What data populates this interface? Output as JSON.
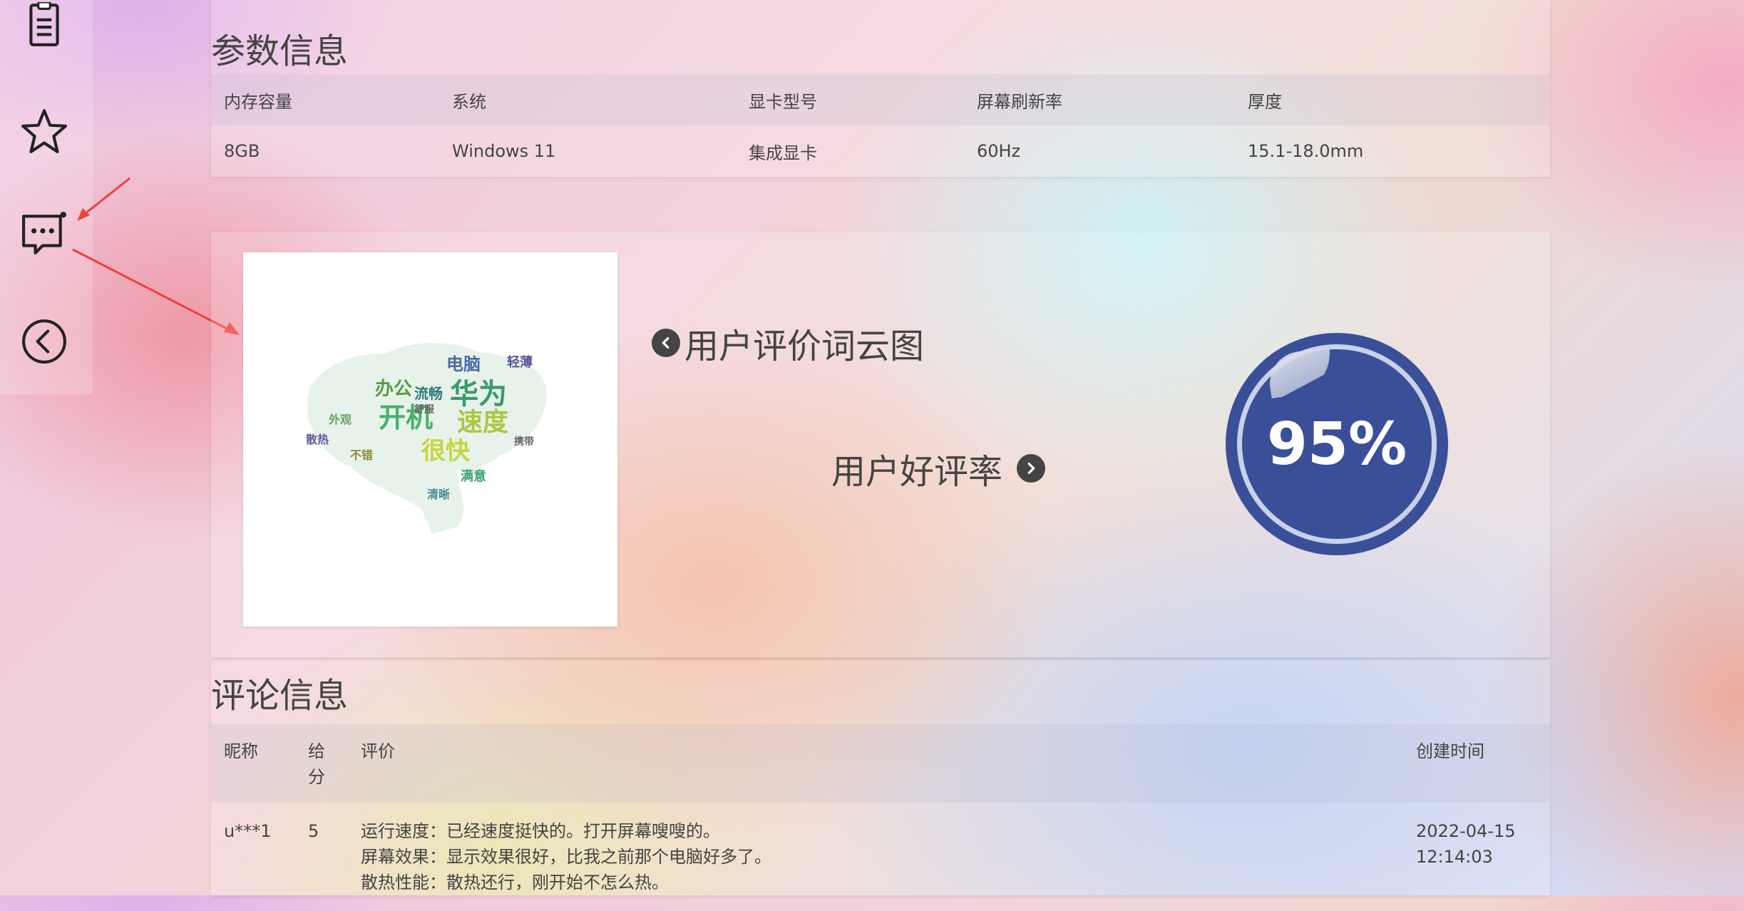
{
  "sidenav": {
    "items": [
      {
        "icon": "clipboard-icon"
      },
      {
        "icon": "star-icon"
      },
      {
        "icon": "comment-icon"
      },
      {
        "icon": "back-arrow-circle-icon"
      }
    ]
  },
  "params": {
    "title": "参数信息",
    "headers": [
      "内存容量",
      "系统",
      "显卡型号",
      "屏幕刷新率",
      "厚度"
    ],
    "row": [
      "8GB",
      "Windows 11",
      "集成显卡",
      "60Hz",
      "15.1-18.0mm"
    ]
  },
  "stats": {
    "wordcloud_label": "用户评价词云图",
    "wordcloud_words": [
      "华为",
      "开机",
      "速度",
      "很快",
      "电脑",
      "办公",
      "流畅",
      "散热",
      "轻薄",
      "外观",
      "舒服",
      "携带",
      "清晰",
      "满意",
      "不错"
    ],
    "rate_label": "用户好评率",
    "rate_value": "95%",
    "rate_fraction": 0.95
  },
  "comments": {
    "title": "评论信息",
    "headers": {
      "nickname": "昵称",
      "score_line1": "给",
      "score_line2": "分",
      "review": "评价",
      "created": "创建时间"
    },
    "rows": [
      {
        "nickname": "u***1",
        "score": "5",
        "review_lines": [
          "运行速度：已经速度挺快的。打开屏幕嗖嗖的。",
          "屏幕效果：显示效果很好，比我之前那个电脑好多了。",
          "散热性能：散热还行，刚开始不怎么热。"
        ],
        "created_date": "2022-04-15",
        "created_time": "12:14:03"
      }
    ]
  },
  "colors": {
    "accent": "#3b4f99",
    "annotation_arrow": "#f0403c"
  }
}
